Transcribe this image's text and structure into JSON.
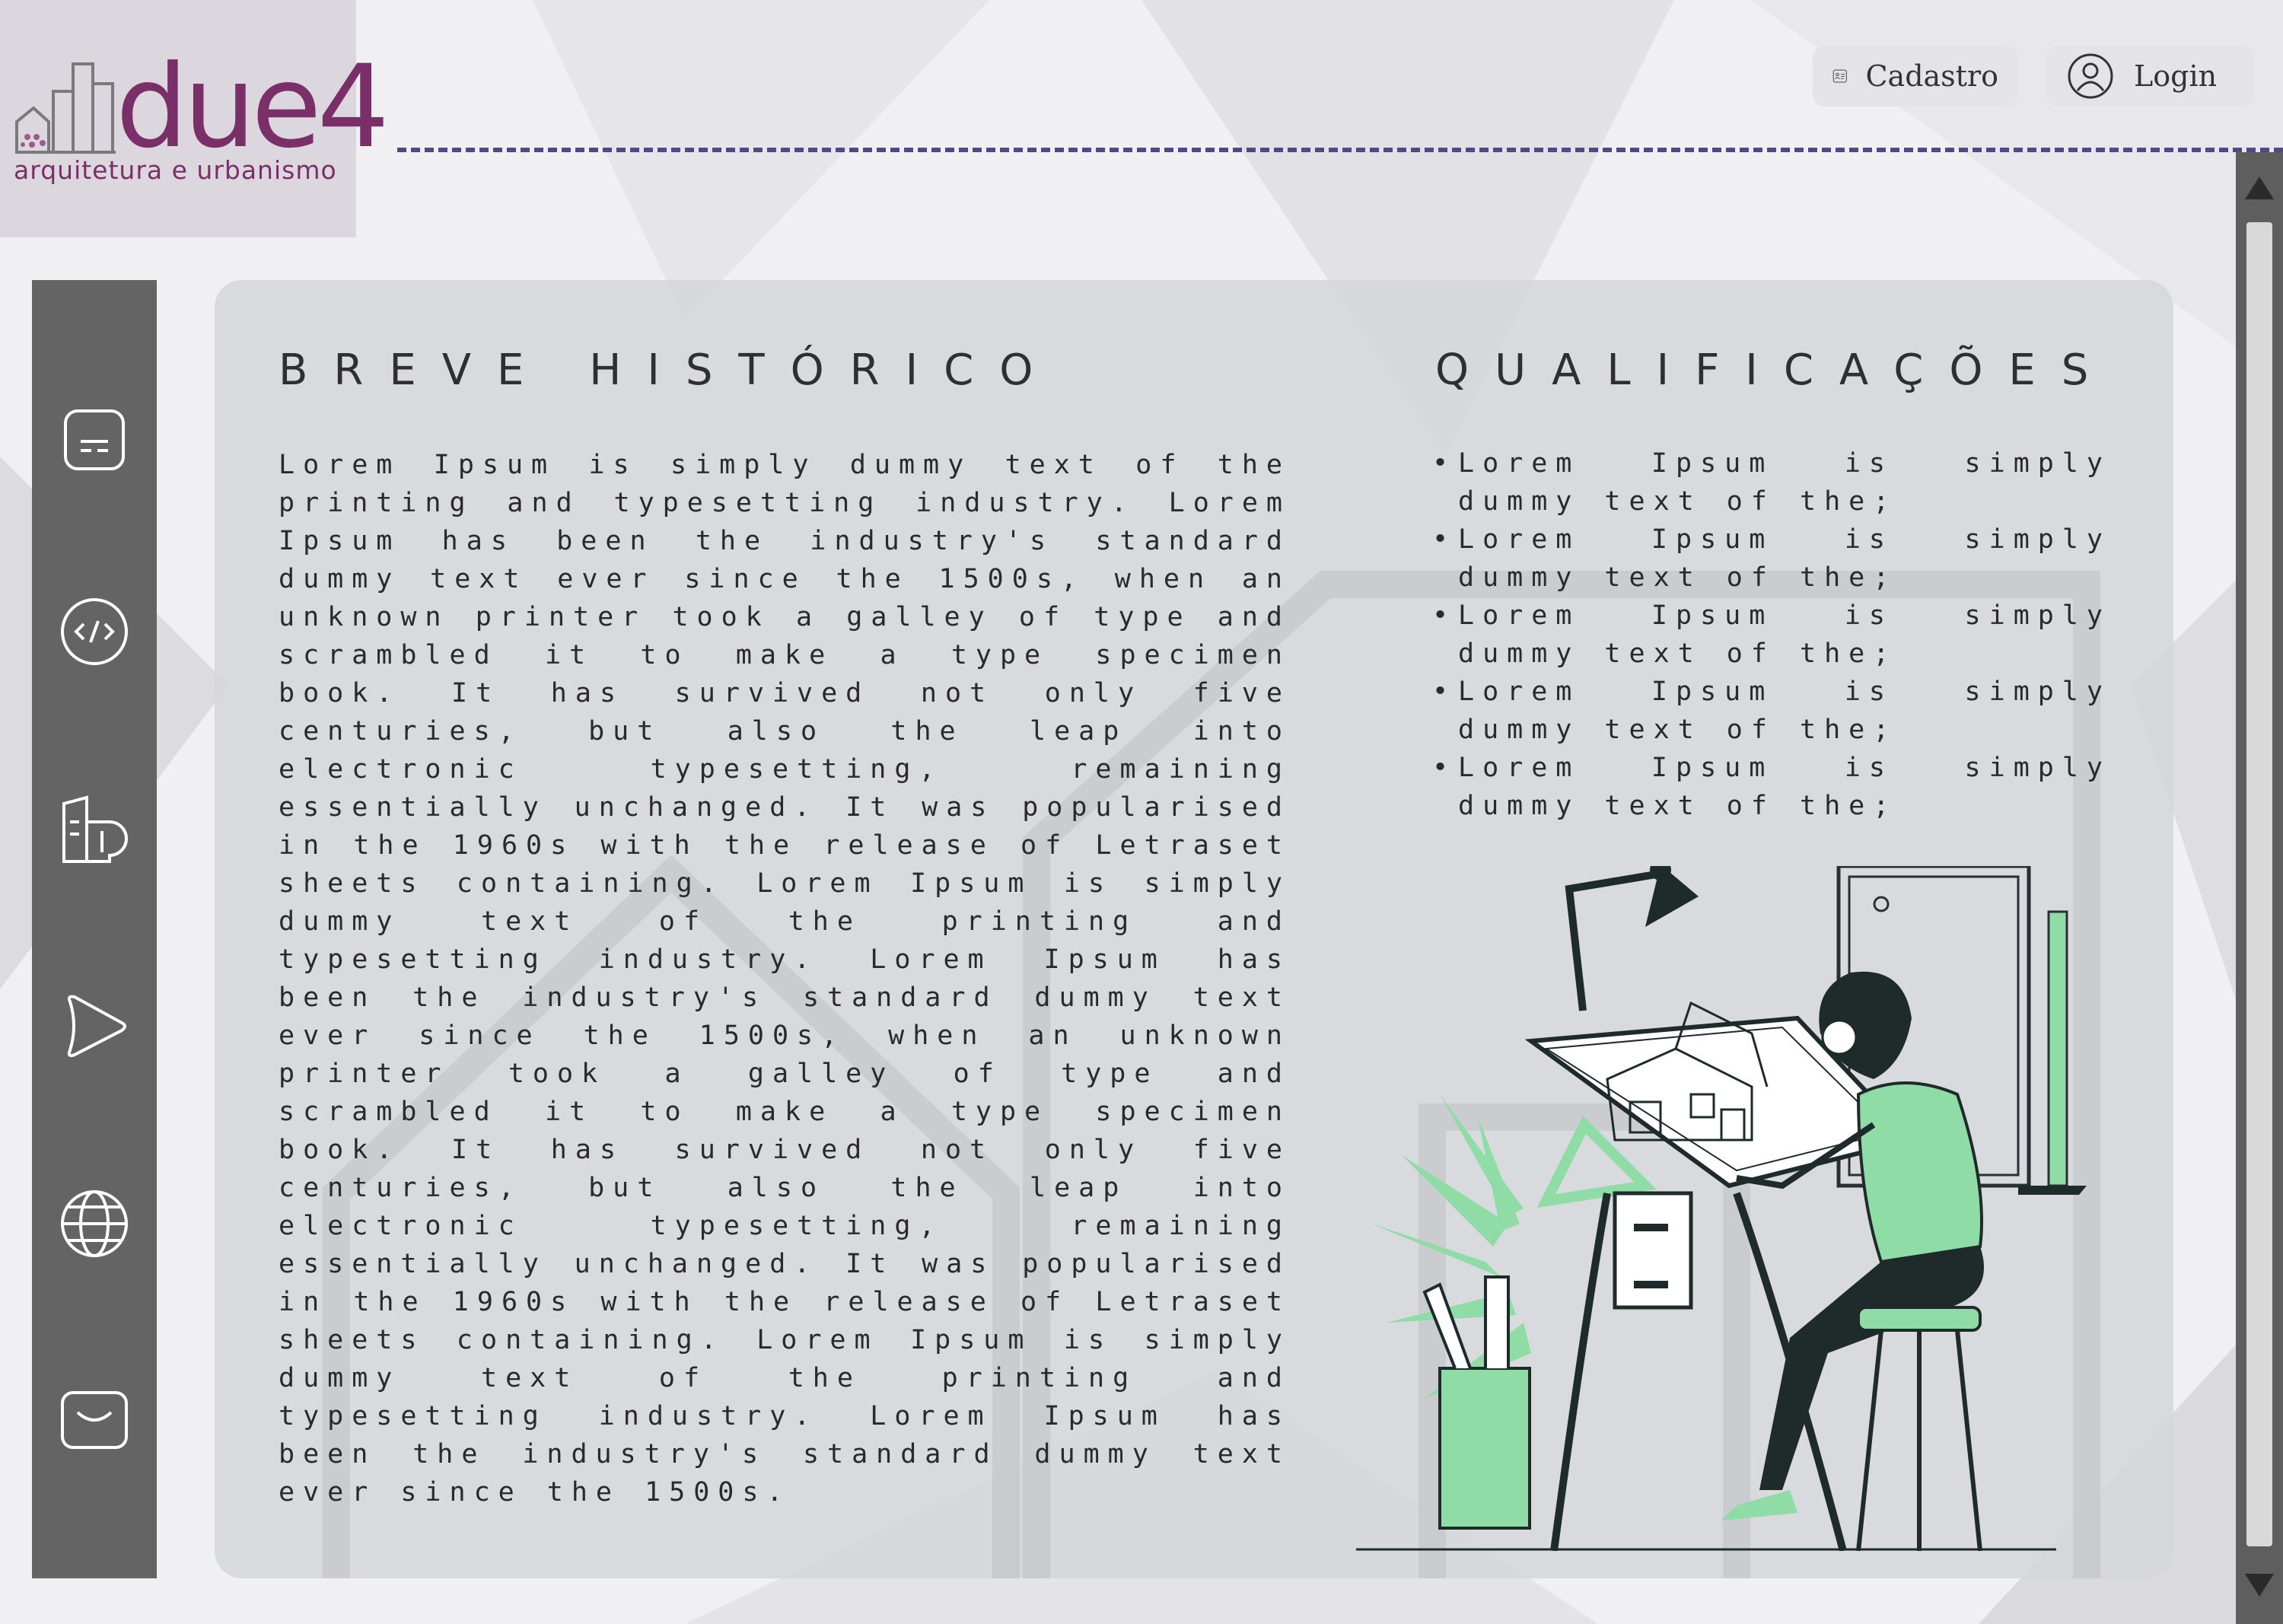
{
  "brand": {
    "name": "due4",
    "tagline": "arquitetura e urbanismo",
    "color": "#7b2f68"
  },
  "header": {
    "buttons": [
      {
        "label": "Cadastro",
        "icon": "id-card-icon"
      },
      {
        "label": "Login",
        "icon": "user-circle-icon"
      }
    ],
    "accent": "#4f4a85"
  },
  "sidebar": {
    "items": [
      {
        "icon": "panel-icon"
      },
      {
        "icon": "code-icon"
      },
      {
        "icon": "building-icon"
      },
      {
        "icon": "play-icon"
      },
      {
        "icon": "globe-icon"
      },
      {
        "icon": "mail-icon"
      }
    ]
  },
  "history": {
    "title": "BREVE HISTÓRICO",
    "text": "Lorem Ipsum is simply dummy text of the printing and typesetting industry. Lorem Ipsum has been the industry's standard dummy text ever since the 1500s, when an unknown printer took a galley of type and scrambled it to make a type specimen book. It has survived not only five centuries, but also the leap into electronic typesetting, remaining essentially unchanged. It was popularised in the 1960s with the release of Letraset sheets containing. Lorem Ipsum is simply dummy text of the printing and typesetting industry. Lorem Ipsum has been the industry's standard dummy text ever since the 1500s, when an unknown printer took a galley of type and scrambled it to make a type specimen book. It has survived not only five centuries, but also the leap into electronic typesetting, remaining essentially unchanged. It was popularised in the 1960s with the release of Letraset sheets containing. Lorem Ipsum is simply dummy text of the printing and typesetting industry. Lorem Ipsum has been the industry's standard dummy text ever since the 1500s."
  },
  "qualifications": {
    "title": "QUALIFICAÇÕES",
    "items": [
      "Lorem Ipsum is simply dummy text of the;",
      "Lorem Ipsum is simply dummy text of the;",
      "Lorem Ipsum is simply dummy text of the;",
      "Lorem Ipsum is simply dummy text of the;",
      "Lorem Ipsum is simply dummy text of the;"
    ]
  },
  "illustration": {
    "subject": "architect drawing a house at drafting table",
    "accent": "#8fdca6"
  }
}
